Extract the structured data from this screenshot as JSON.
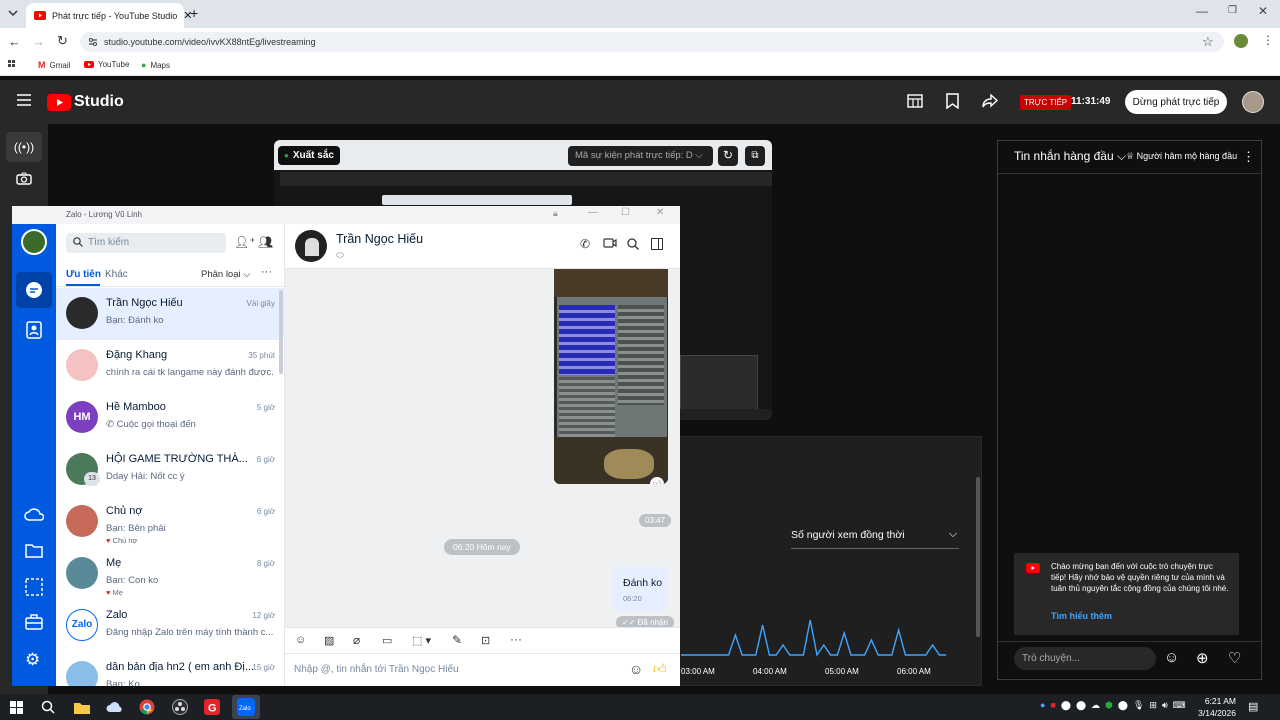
{
  "browser": {
    "tab_title": "Phát trực tiếp - YouTube Studio",
    "url": "studio.youtube.com/video/ivvKX88ntEg/livestreaming",
    "bookmarks": [
      "Gmail",
      "YouTube",
      "Maps"
    ]
  },
  "studio": {
    "logo": "Studio",
    "live_badge": "TRỰC TIẾP",
    "elapsed": "11:31:49",
    "end_button": "Dừng phát trực tiếp",
    "preview": {
      "quality": "Xuất sắc",
      "event_placeholder": "Mã sự kiện phát trực tiếp: D"
    },
    "chat": {
      "mode": "Tin nhắn hàng đầu",
      "top_fans": "Người hâm mộ hàng đầu",
      "welcome": "Chào mừng bạn đến với cuộc trò chuyện trực tiếp! Hãy nhớ bảo vệ quyền riêng tư của mình và tuân thủ nguyên tắc cộng đồng của chúng tôi nhé.",
      "learn_more": "Tìm hiểu thêm",
      "input_placeholder": "Trò chuyện..."
    },
    "stats": {
      "metric": "Số người xem đồng thời",
      "ticks": [
        "03:00 AM",
        "04:00 AM",
        "05:00 AM",
        "06:00 AM"
      ]
    }
  },
  "zalo": {
    "window_title": "Zalo - Lương Vũ Linh",
    "search_placeholder": "Tìm kiếm",
    "tab_priority": "Ưu tiên",
    "tab_other": "Khác",
    "classify": "Phân loại",
    "conversations": [
      {
        "name": "Trần Ngọc Hiếu",
        "msg": "Bạn: Đánh ko",
        "time": "Vài giây"
      },
      {
        "name": "Đặng Khang",
        "msg": "chính ra cái tk langame này đánh được...",
        "time": "35 phút"
      },
      {
        "name": "Hề Mamboo",
        "msg": "Cuộc gọi thoại đến",
        "time": "5 giờ",
        "initials": "HM"
      },
      {
        "name": "HỘI GAME TRƯỜNG THÀ...",
        "msg": "Dday Hải: Nốt cc ý",
        "time": "6 giờ",
        "badge": "13"
      },
      {
        "name": "Chủ nợ",
        "msg": "Bạn: Bên phải",
        "time": "6 giờ",
        "tag": "Chủ nợ"
      },
      {
        "name": "Mẹ",
        "msg": "Bạn: Con ko",
        "time": "8 giờ",
        "tag": "Mẹ"
      },
      {
        "name": "Zalo",
        "msg": "Đăng nhập Zalo trên máy tính thành c...",
        "time": "12 giờ"
      },
      {
        "name": "dân bản địa hn2 ( em anh Đị...",
        "msg": "Bạn: Ko",
        "time": "15 giờ"
      }
    ],
    "chat": {
      "contact": "Trần Ngọc Hiếu",
      "img_time": "03:47",
      "date_divider": "06:20 Hôm nay",
      "msg_text": "Đánh ko",
      "msg_time": "06:20",
      "status": "Đã nhận",
      "input_placeholder": "Nhập @, tin nhắn tới Trần Ngọc Hiếu"
    }
  },
  "taskbar": {
    "time": "6:21 AM",
    "date": "3/14/2026"
  }
}
